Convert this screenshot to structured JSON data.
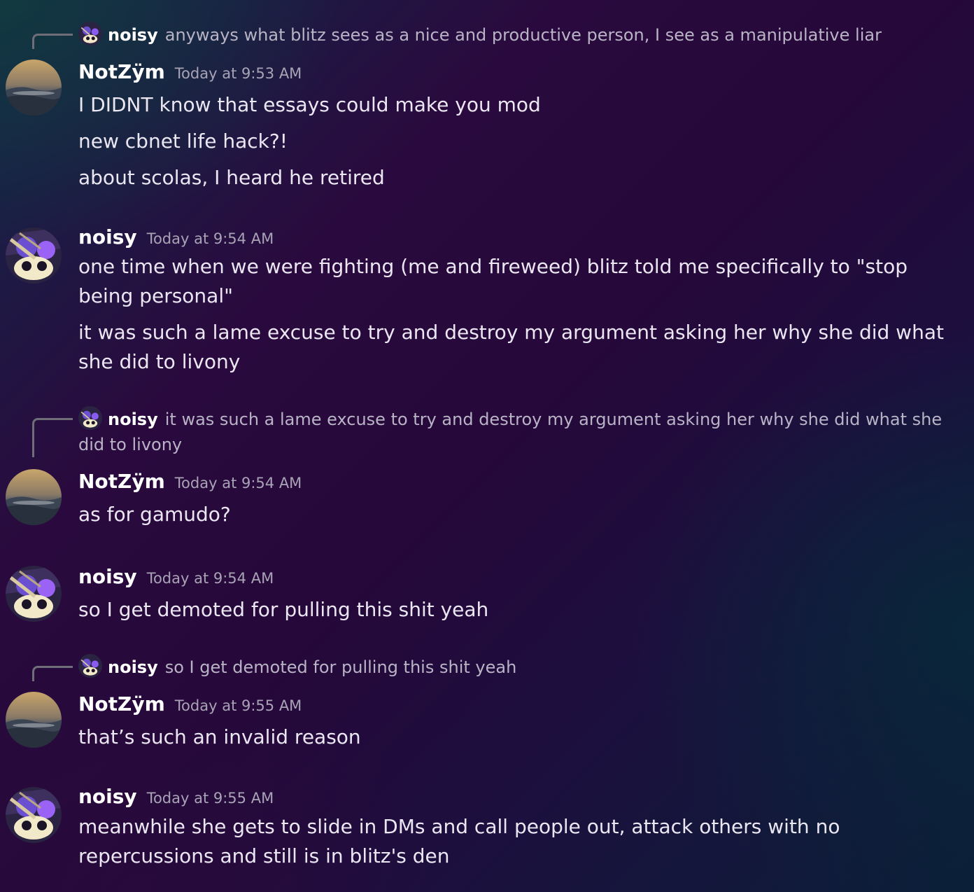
{
  "messages": [
    {
      "reply": {
        "author": "noisy",
        "text": "anyways what blitz sees as a nice and productive person, I see as a manipulative liar"
      },
      "author": "NotZÿm",
      "timestamp": "Today at 9:53 AM",
      "lines": [
        "I DIDNT know that essays could make you mod",
        "new cbnet life hack?!",
        "about scolas, I heard he retired"
      ]
    },
    {
      "author": "noisy",
      "timestamp": "Today at 9:54 AM",
      "lines": [
        "one time when we were fighting (me and fireweed) blitz told me specifically to \"stop being personal\"",
        "it was such a lame excuse to try and destroy my argument asking her why she did what she did to livony"
      ]
    },
    {
      "reply": {
        "author": "noisy",
        "text": "it was such a lame excuse to try and destroy my argument asking her why she did what she did to livony"
      },
      "author": "NotZÿm",
      "timestamp": "Today at 9:54 AM",
      "lines": [
        "as for gamudo?"
      ]
    },
    {
      "author": "noisy",
      "timestamp": "Today at 9:54 AM",
      "lines": [
        "so I get demoted for pulling this shit yeah"
      ]
    },
    {
      "reply": {
        "author": "noisy",
        "text": "so I get demoted for pulling this shit yeah"
      },
      "author": "NotZÿm",
      "timestamp": "Today at 9:55 AM",
      "lines": [
        "that’s such an invalid reason"
      ]
    },
    {
      "author": "noisy",
      "timestamp": "Today at 9:55 AM",
      "lines": [
        "meanwhile she gets to slide in DMs and call people out, attack others with no repercussions and still is in blitz's den"
      ]
    }
  ]
}
